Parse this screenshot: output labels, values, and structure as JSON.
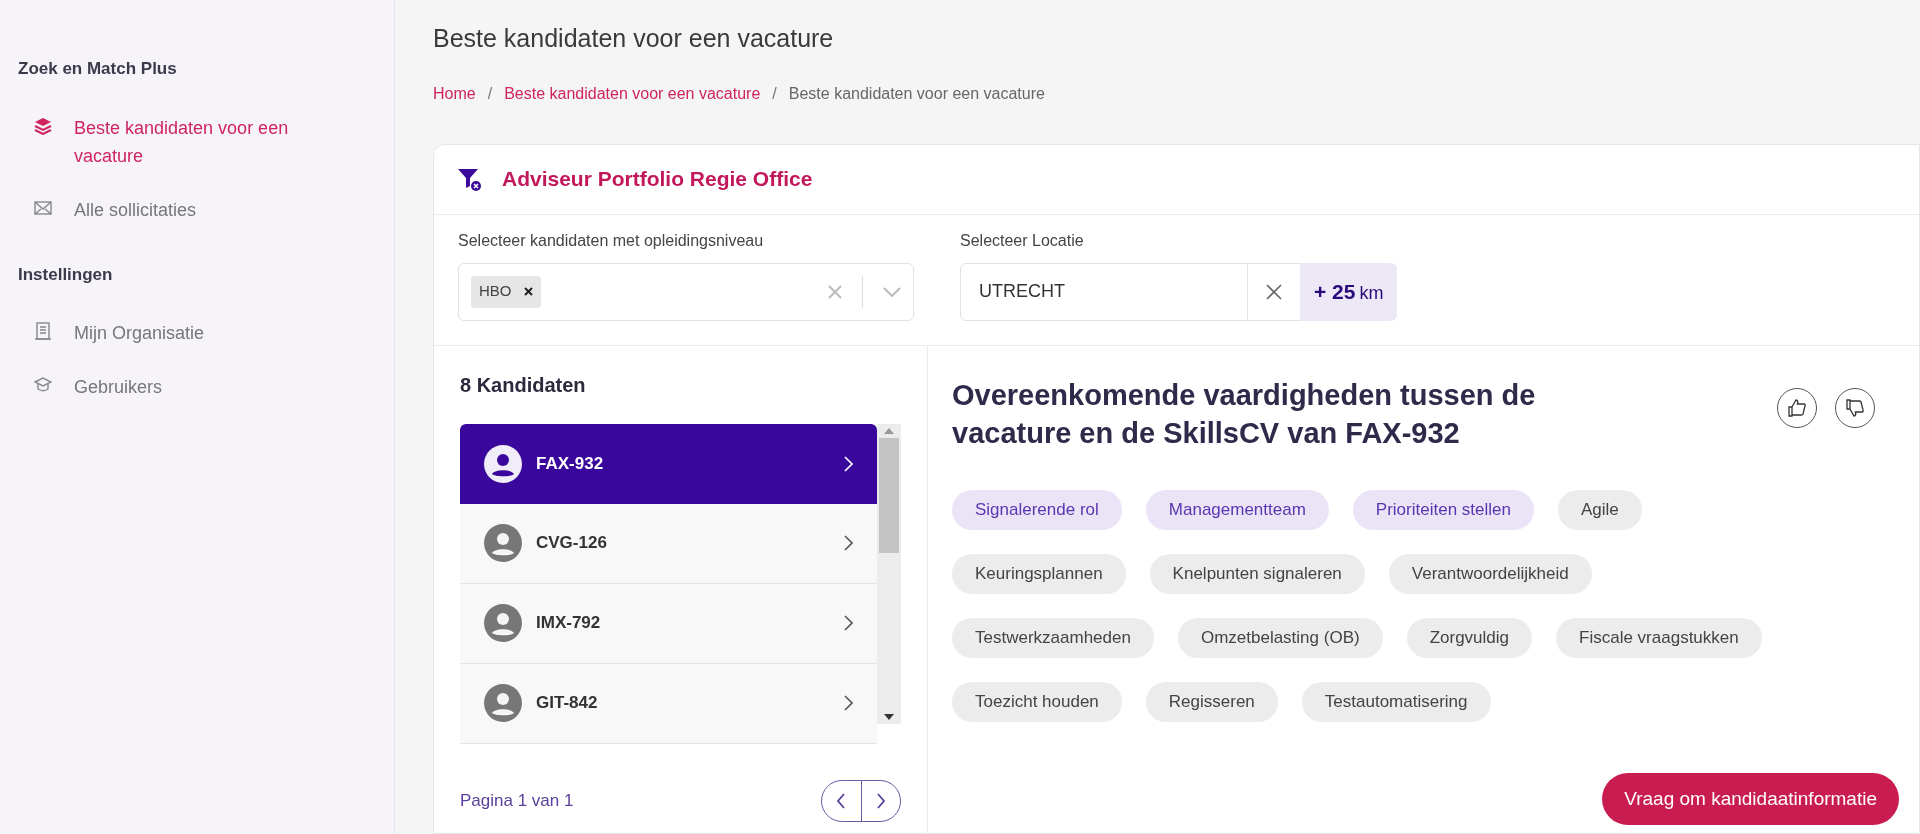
{
  "sidebar": {
    "sections": [
      {
        "title": "Zoek en Match Plus",
        "items": [
          {
            "label": "Beste kandidaten voor een vacature",
            "selected": true
          },
          {
            "label": "Alle sollicitaties",
            "selected": false
          }
        ]
      },
      {
        "title": "Instellingen",
        "items": [
          {
            "label": "Mijn Organisatie",
            "selected": false
          },
          {
            "label": "Gebruikers",
            "selected": false
          }
        ]
      }
    ]
  },
  "page_title": "Beste kandidaten voor een vacature",
  "breadcrumb": [
    {
      "label": "Home",
      "link": true
    },
    {
      "separator": "/",
      "label": "Beste kandidaten voor een vacature",
      "link": true
    },
    {
      "separator": "/",
      "label": "Beste kandidaten voor een vacature",
      "link": false
    }
  ],
  "vacancy": {
    "title": "Adviseur Portfolio Regie Office",
    "education_filter": {
      "label": "Selecteer kandidaten met opleidingsniveau",
      "tags": [
        "HBO"
      ]
    },
    "location_filter": {
      "label": "Selecteer Locatie",
      "value": "UTRECHT",
      "radius": "+ 25",
      "unit": "km"
    }
  },
  "candidates": {
    "count": "8 Kandidaten",
    "items": [
      {
        "id": "FAX-932",
        "selected": true
      },
      {
        "id": "CVG-126",
        "selected": false
      },
      {
        "id": "IMX-792",
        "selected": false
      },
      {
        "id": "GIT-842",
        "selected": false
      }
    ],
    "pagination": "Pagina 1 van 1"
  },
  "skills": {
    "heading": "Overeenkomende vaardigheden tussen de vacature en de SkillsCV van FAX-932",
    "chips": [
      {
        "label": "Signalerende rol",
        "highlighted": true
      },
      {
        "label": "Managementteam",
        "highlighted": true
      },
      {
        "label": "Prioriteiten stellen",
        "highlighted": true
      },
      {
        "label": "Agile",
        "highlighted": false
      },
      {
        "label": "Keuringsplannen",
        "highlighted": false
      },
      {
        "label": "Knelpunten signaleren",
        "highlighted": false
      },
      {
        "label": "Verantwoordelijkheid",
        "highlighted": false
      },
      {
        "label": "Testwerkzaamheden",
        "highlighted": false
      },
      {
        "label": "Omzetbelasting (OB)",
        "highlighted": false
      },
      {
        "label": "Zorgvuldig",
        "highlighted": false
      },
      {
        "label": "Fiscale vraagstukken",
        "highlighted": false
      },
      {
        "label": "Toezicht houden",
        "highlighted": false
      },
      {
        "label": "Regisseren",
        "highlighted": false
      },
      {
        "label": "Testautomatisering",
        "highlighted": false
      }
    ],
    "request_button": "Vraag om kandidaatinformatie"
  }
}
